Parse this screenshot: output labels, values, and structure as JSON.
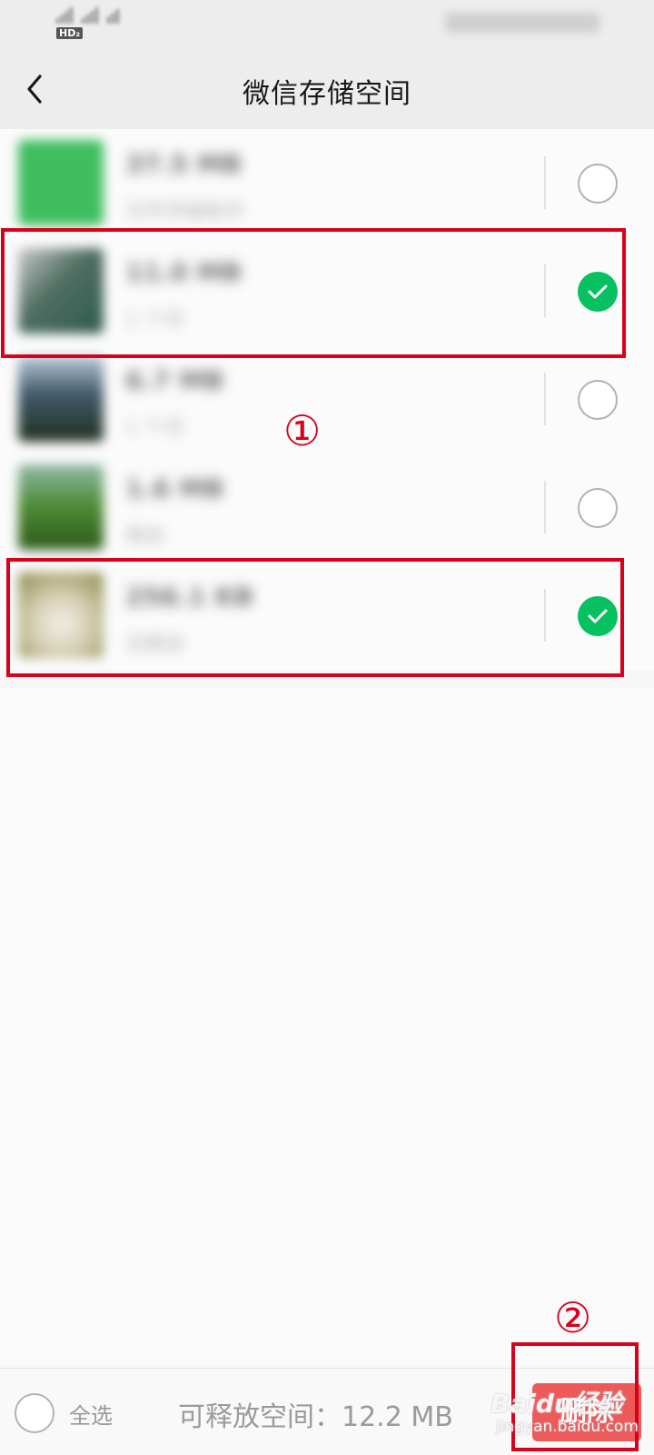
{
  "nav": {
    "title": "微信存储空间",
    "back_icon": "chevron-left-icon"
  },
  "list": {
    "items": [
      {
        "size": "37.5 MB",
        "sub": "文件传输助手",
        "checked": false,
        "thumb_color": "#3fbd5f"
      },
      {
        "size": "11.0 MB",
        "sub": "1 个月",
        "checked": true,
        "thumb_color": "#2f5a4e"
      },
      {
        "size": "6.7 MB",
        "sub": "1 个月",
        "checked": false,
        "thumb_color": "#2e4250"
      },
      {
        "size": "1.6 MB",
        "sub": "剩余",
        "checked": false,
        "thumb_color": "#3f7a2c"
      },
      {
        "size": "256.1 KB",
        "sub": "无剩余",
        "checked": true,
        "thumb_color": "#c9c2a0"
      }
    ]
  },
  "annotations": {
    "marker_1": "①",
    "marker_2": "②"
  },
  "bottom": {
    "select_all_label": "全选",
    "free_space_text": "可释放空间：12.2 MB",
    "delete_label": "删除"
  },
  "watermark": {
    "main": "Baidu经验",
    "sub": "jingyan.baidu.com"
  },
  "colors": {
    "accent_green": "#07c160",
    "delete_red": "#ee5a5a",
    "annotation_red": "#d9001b"
  }
}
